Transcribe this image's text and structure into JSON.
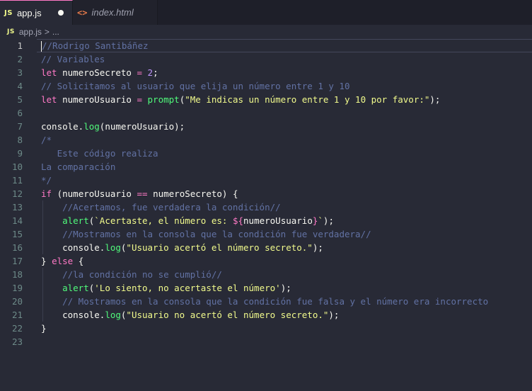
{
  "tabs": [
    {
      "icon": "JS",
      "label": "app.js",
      "modified": true
    },
    {
      "icon": "<>",
      "label": "index.html"
    }
  ],
  "breadcrumb": {
    "icon": "JS",
    "file": "app.js",
    "separator": ">",
    "more": "..."
  },
  "colors": {
    "comment": "#6272a4",
    "keyword": "#ff79c6",
    "number": "#bd93f9",
    "function": "#50fa7b",
    "string": "#f1fa8c",
    "text": "#f8f8f2"
  },
  "code": {
    "current_line": 1,
    "lines": [
      {
        "n": "1",
        "tokens": [
          {
            "t": "c",
            "v": "//Rodrigo Santibáñez"
          }
        ]
      },
      {
        "n": "2",
        "tokens": [
          {
            "t": "c",
            "v": "// Variables"
          }
        ]
      },
      {
        "n": "3",
        "tokens": [
          {
            "t": "k",
            "v": "let"
          },
          {
            "t": "v",
            "v": " numeroSecreto "
          },
          {
            "t": "o",
            "v": "="
          },
          {
            "t": "v",
            "v": " "
          },
          {
            "t": "n",
            "v": "2"
          },
          {
            "t": "v",
            "v": ";"
          }
        ]
      },
      {
        "n": "4",
        "tokens": [
          {
            "t": "c",
            "v": "// Solicitamos al usuario que elija un número entre 1 y 10"
          }
        ]
      },
      {
        "n": "5",
        "tokens": [
          {
            "t": "k",
            "v": "let"
          },
          {
            "t": "v",
            "v": " numeroUsuario "
          },
          {
            "t": "o",
            "v": "="
          },
          {
            "t": "v",
            "v": " "
          },
          {
            "t": "f",
            "v": "prompt"
          },
          {
            "t": "v",
            "v": "("
          },
          {
            "t": "s",
            "v": "\"Me indicas un número entre 1 y 10 por favor:\""
          },
          {
            "t": "v",
            "v": ");"
          }
        ]
      },
      {
        "n": "6",
        "tokens": []
      },
      {
        "n": "7",
        "tokens": [
          {
            "t": "v",
            "v": "console."
          },
          {
            "t": "f",
            "v": "log"
          },
          {
            "t": "v",
            "v": "(numeroUsuario);"
          }
        ]
      },
      {
        "n": "8",
        "tokens": [
          {
            "t": "c",
            "v": "/*"
          }
        ]
      },
      {
        "n": "9",
        "tokens": [
          {
            "t": "c",
            "v": "   Este código realiza"
          }
        ]
      },
      {
        "n": "10",
        "tokens": [
          {
            "t": "c",
            "v": "La comparación"
          }
        ]
      },
      {
        "n": "11",
        "tokens": [
          {
            "t": "c",
            "v": "*/"
          }
        ]
      },
      {
        "n": "12",
        "tokens": [
          {
            "t": "k",
            "v": "if"
          },
          {
            "t": "v",
            "v": " (numeroUsuario "
          },
          {
            "t": "o",
            "v": "=="
          },
          {
            "t": "v",
            "v": " numeroSecreto) {"
          }
        ]
      },
      {
        "n": "13",
        "tokens": [
          {
            "t": "v",
            "v": "    "
          },
          {
            "t": "c",
            "v": "//Acertamos, fue verdadera la condición//"
          }
        ]
      },
      {
        "n": "14",
        "tokens": [
          {
            "t": "v",
            "v": "    "
          },
          {
            "t": "f",
            "v": "alert"
          },
          {
            "t": "v",
            "v": "("
          },
          {
            "t": "s",
            "v": "`Acertaste, el número es: "
          },
          {
            "t": "k",
            "v": "${"
          },
          {
            "t": "v",
            "v": "numeroUsuario"
          },
          {
            "t": "k",
            "v": "}"
          },
          {
            "t": "s",
            "v": "`"
          },
          {
            "t": "v",
            "v": ");"
          }
        ]
      },
      {
        "n": "15",
        "tokens": [
          {
            "t": "v",
            "v": "    "
          },
          {
            "t": "c",
            "v": "//Mostramos en la consola que la condición fue verdadera//"
          }
        ]
      },
      {
        "n": "16",
        "tokens": [
          {
            "t": "v",
            "v": "    console."
          },
          {
            "t": "f",
            "v": "log"
          },
          {
            "t": "v",
            "v": "("
          },
          {
            "t": "s",
            "v": "\"Usuario acertó el número secreto.\""
          },
          {
            "t": "v",
            "v": ");"
          }
        ]
      },
      {
        "n": "17",
        "tokens": [
          {
            "t": "v",
            "v": "} "
          },
          {
            "t": "k",
            "v": "else"
          },
          {
            "t": "v",
            "v": " {"
          }
        ]
      },
      {
        "n": "18",
        "tokens": [
          {
            "t": "v",
            "v": "    "
          },
          {
            "t": "c",
            "v": "//la condición no se cumplió//"
          }
        ]
      },
      {
        "n": "19",
        "tokens": [
          {
            "t": "v",
            "v": "    "
          },
          {
            "t": "f",
            "v": "alert"
          },
          {
            "t": "v",
            "v": "("
          },
          {
            "t": "s",
            "v": "'Lo siento, no acertaste el número'"
          },
          {
            "t": "v",
            "v": ");"
          }
        ]
      },
      {
        "n": "20",
        "tokens": [
          {
            "t": "v",
            "v": "    "
          },
          {
            "t": "c",
            "v": "// Mostramos en la consola que la condición fue falsa y el número era incorrecto"
          }
        ]
      },
      {
        "n": "21",
        "tokens": [
          {
            "t": "v",
            "v": "    console."
          },
          {
            "t": "f",
            "v": "log"
          },
          {
            "t": "v",
            "v": "("
          },
          {
            "t": "s",
            "v": "\"Usuario no acertó el número secreto.\""
          },
          {
            "t": "v",
            "v": ");"
          }
        ]
      },
      {
        "n": "22",
        "tokens": [
          {
            "t": "v",
            "v": "}"
          }
        ]
      },
      {
        "n": "23",
        "tokens": []
      }
    ]
  }
}
